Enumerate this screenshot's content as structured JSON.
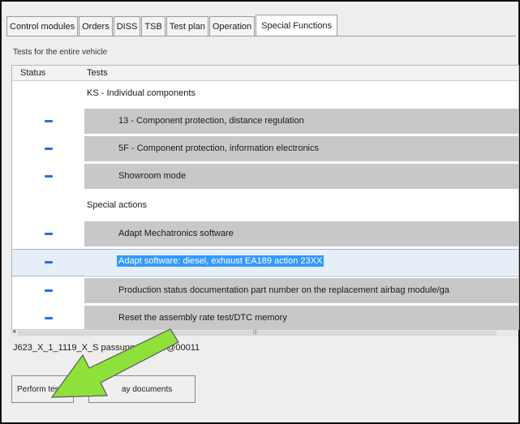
{
  "tabs": [
    "Control modules",
    "Orders",
    "DISS",
    "TSB",
    "Test plan",
    "Operation",
    "Special Functions"
  ],
  "active_tab": "Special Functions",
  "header_label": "Tests for the entire vehicle",
  "columns": {
    "status": "Status",
    "tests": "Tests"
  },
  "rows": [
    {
      "type": "section",
      "text": "KS - Individual components"
    },
    {
      "type": "item",
      "text": "13 - Component protection, distance regulation",
      "status_icon": "dash-icon"
    },
    {
      "type": "item",
      "text": "5F - Component protection, information electronics",
      "status_icon": "dash-icon"
    },
    {
      "type": "item",
      "text": "Showroom mode",
      "status_icon": "dash-icon"
    },
    {
      "type": "section",
      "text": "Special actions"
    },
    {
      "type": "item",
      "text": "Adapt Mechatronics software",
      "status_icon": "dash-icon"
    },
    {
      "type": "selected",
      "text": "Adapt software: diesel, exhaust EA189 action 23XX",
      "status_icon": "dash-icon"
    },
    {
      "type": "item",
      "text": "Production status documentation part number on the replacement airbag module/ga",
      "status_icon": "dash-icon"
    },
    {
      "type": "item",
      "text": "Reset the assembly rate test/DTC memory",
      "status_icon": "dash-icon"
    }
  ],
  "filename": "J623_X_1_1119_X_S        passung_EA189@00011",
  "buttons": {
    "perform": "Perform test...",
    "documents": "ay documents"
  },
  "colors": {
    "accent": "#3399ff",
    "arrow": "#8ee13a",
    "status_dash": "#2a6fdb"
  }
}
